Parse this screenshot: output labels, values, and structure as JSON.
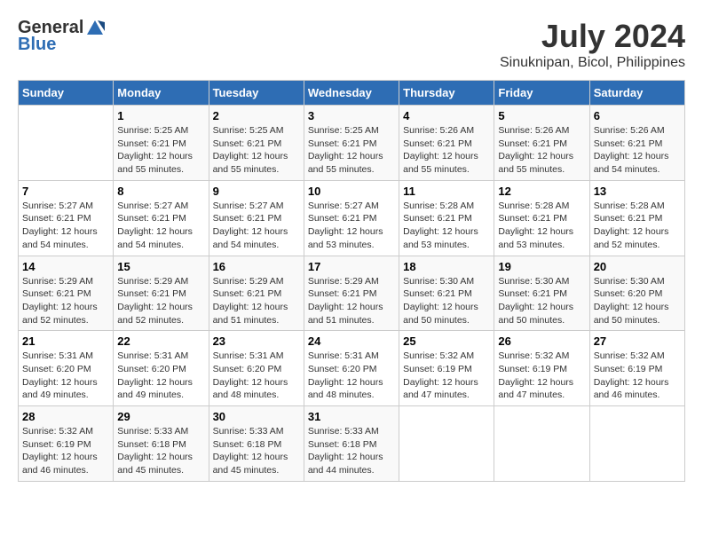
{
  "header": {
    "logo_general": "General",
    "logo_blue": "Blue",
    "month_year": "July 2024",
    "location": "Sinuknipan, Bicol, Philippines"
  },
  "columns": [
    "Sunday",
    "Monday",
    "Tuesday",
    "Wednesday",
    "Thursday",
    "Friday",
    "Saturday"
  ],
  "weeks": [
    [
      {
        "day": "",
        "content": ""
      },
      {
        "day": "1",
        "content": "Sunrise: 5:25 AM\nSunset: 6:21 PM\nDaylight: 12 hours\nand 55 minutes."
      },
      {
        "day": "2",
        "content": "Sunrise: 5:25 AM\nSunset: 6:21 PM\nDaylight: 12 hours\nand 55 minutes."
      },
      {
        "day": "3",
        "content": "Sunrise: 5:25 AM\nSunset: 6:21 PM\nDaylight: 12 hours\nand 55 minutes."
      },
      {
        "day": "4",
        "content": "Sunrise: 5:26 AM\nSunset: 6:21 PM\nDaylight: 12 hours\nand 55 minutes."
      },
      {
        "day": "5",
        "content": "Sunrise: 5:26 AM\nSunset: 6:21 PM\nDaylight: 12 hours\nand 55 minutes."
      },
      {
        "day": "6",
        "content": "Sunrise: 5:26 AM\nSunset: 6:21 PM\nDaylight: 12 hours\nand 54 minutes."
      }
    ],
    [
      {
        "day": "7",
        "content": "Sunrise: 5:27 AM\nSunset: 6:21 PM\nDaylight: 12 hours\nand 54 minutes."
      },
      {
        "day": "8",
        "content": "Sunrise: 5:27 AM\nSunset: 6:21 PM\nDaylight: 12 hours\nand 54 minutes."
      },
      {
        "day": "9",
        "content": "Sunrise: 5:27 AM\nSunset: 6:21 PM\nDaylight: 12 hours\nand 54 minutes."
      },
      {
        "day": "10",
        "content": "Sunrise: 5:27 AM\nSunset: 6:21 PM\nDaylight: 12 hours\nand 53 minutes."
      },
      {
        "day": "11",
        "content": "Sunrise: 5:28 AM\nSunset: 6:21 PM\nDaylight: 12 hours\nand 53 minutes."
      },
      {
        "day": "12",
        "content": "Sunrise: 5:28 AM\nSunset: 6:21 PM\nDaylight: 12 hours\nand 53 minutes."
      },
      {
        "day": "13",
        "content": "Sunrise: 5:28 AM\nSunset: 6:21 PM\nDaylight: 12 hours\nand 52 minutes."
      }
    ],
    [
      {
        "day": "14",
        "content": "Sunrise: 5:29 AM\nSunset: 6:21 PM\nDaylight: 12 hours\nand 52 minutes."
      },
      {
        "day": "15",
        "content": "Sunrise: 5:29 AM\nSunset: 6:21 PM\nDaylight: 12 hours\nand 52 minutes."
      },
      {
        "day": "16",
        "content": "Sunrise: 5:29 AM\nSunset: 6:21 PM\nDaylight: 12 hours\nand 51 minutes."
      },
      {
        "day": "17",
        "content": "Sunrise: 5:29 AM\nSunset: 6:21 PM\nDaylight: 12 hours\nand 51 minutes."
      },
      {
        "day": "18",
        "content": "Sunrise: 5:30 AM\nSunset: 6:21 PM\nDaylight: 12 hours\nand 50 minutes."
      },
      {
        "day": "19",
        "content": "Sunrise: 5:30 AM\nSunset: 6:21 PM\nDaylight: 12 hours\nand 50 minutes."
      },
      {
        "day": "20",
        "content": "Sunrise: 5:30 AM\nSunset: 6:20 PM\nDaylight: 12 hours\nand 50 minutes."
      }
    ],
    [
      {
        "day": "21",
        "content": "Sunrise: 5:31 AM\nSunset: 6:20 PM\nDaylight: 12 hours\nand 49 minutes."
      },
      {
        "day": "22",
        "content": "Sunrise: 5:31 AM\nSunset: 6:20 PM\nDaylight: 12 hours\nand 49 minutes."
      },
      {
        "day": "23",
        "content": "Sunrise: 5:31 AM\nSunset: 6:20 PM\nDaylight: 12 hours\nand 48 minutes."
      },
      {
        "day": "24",
        "content": "Sunrise: 5:31 AM\nSunset: 6:20 PM\nDaylight: 12 hours\nand 48 minutes."
      },
      {
        "day": "25",
        "content": "Sunrise: 5:32 AM\nSunset: 6:19 PM\nDaylight: 12 hours\nand 47 minutes."
      },
      {
        "day": "26",
        "content": "Sunrise: 5:32 AM\nSunset: 6:19 PM\nDaylight: 12 hours\nand 47 minutes."
      },
      {
        "day": "27",
        "content": "Sunrise: 5:32 AM\nSunset: 6:19 PM\nDaylight: 12 hours\nand 46 minutes."
      }
    ],
    [
      {
        "day": "28",
        "content": "Sunrise: 5:32 AM\nSunset: 6:19 PM\nDaylight: 12 hours\nand 46 minutes."
      },
      {
        "day": "29",
        "content": "Sunrise: 5:33 AM\nSunset: 6:18 PM\nDaylight: 12 hours\nand 45 minutes."
      },
      {
        "day": "30",
        "content": "Sunrise: 5:33 AM\nSunset: 6:18 PM\nDaylight: 12 hours\nand 45 minutes."
      },
      {
        "day": "31",
        "content": "Sunrise: 5:33 AM\nSunset: 6:18 PM\nDaylight: 12 hours\nand 44 minutes."
      },
      {
        "day": "",
        "content": ""
      },
      {
        "day": "",
        "content": ""
      },
      {
        "day": "",
        "content": ""
      }
    ]
  ]
}
